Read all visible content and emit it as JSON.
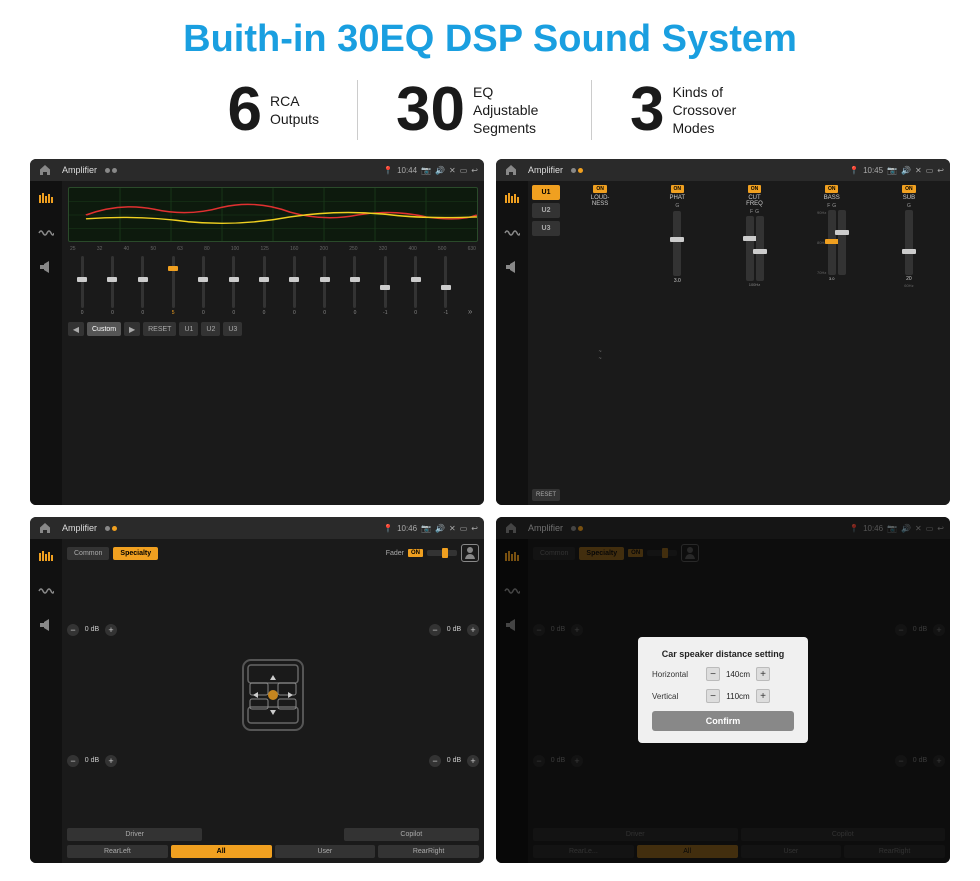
{
  "page": {
    "title": "Buith-in 30EQ DSP Sound System",
    "background": "#ffffff"
  },
  "stats": [
    {
      "number": "6",
      "text": "RCA\nOutputs"
    },
    {
      "number": "30",
      "text": "EQ Adjustable\nSegments"
    },
    {
      "number": "3",
      "text": "Kinds of\nCrossover Modes"
    }
  ],
  "screens": [
    {
      "id": "screen1",
      "title": "Amplifier",
      "time": "10:44",
      "type": "eq",
      "eq_values": [
        "0",
        "0",
        "0",
        "5",
        "0",
        "0",
        "0",
        "0",
        "0",
        "0",
        "-1",
        "0",
        "-1"
      ],
      "eq_buttons": [
        "Custom",
        "RESET",
        "U1",
        "U2",
        "U3"
      ]
    },
    {
      "id": "screen2",
      "title": "Amplifier",
      "time": "10:45",
      "type": "crossover",
      "presets": [
        "U1",
        "U2",
        "U3"
      ],
      "channels": [
        "LOUDNESS",
        "PHAT",
        "CUT FREQ",
        "BASS",
        "SUB"
      ]
    },
    {
      "id": "screen3",
      "title": "Amplifier",
      "time": "10:46",
      "type": "fader",
      "tabs": [
        "Common",
        "Specialty"
      ],
      "fader_label": "Fader",
      "db_values": [
        "0 dB",
        "0 dB",
        "0 dB",
        "0 dB"
      ],
      "bottom_buttons": [
        "Driver",
        "",
        "",
        "Copilot",
        "RearLeft",
        "All",
        "User",
        "RearRight"
      ]
    },
    {
      "id": "screen4",
      "title": "Amplifier",
      "time": "10:46",
      "type": "fader_dialog",
      "tabs": [
        "Common",
        "Specialty"
      ],
      "dialog": {
        "title": "Car speaker distance setting",
        "horizontal_label": "Horizontal",
        "horizontal_value": "140cm",
        "vertical_label": "Vertical",
        "vertical_value": "110cm",
        "confirm_label": "Confirm"
      },
      "db_values": [
        "0 dB",
        "0 dB"
      ],
      "bottom_buttons": [
        "Driver",
        "",
        "Copilot",
        "RearLeft",
        "All",
        "User",
        "RearRight"
      ]
    }
  ]
}
